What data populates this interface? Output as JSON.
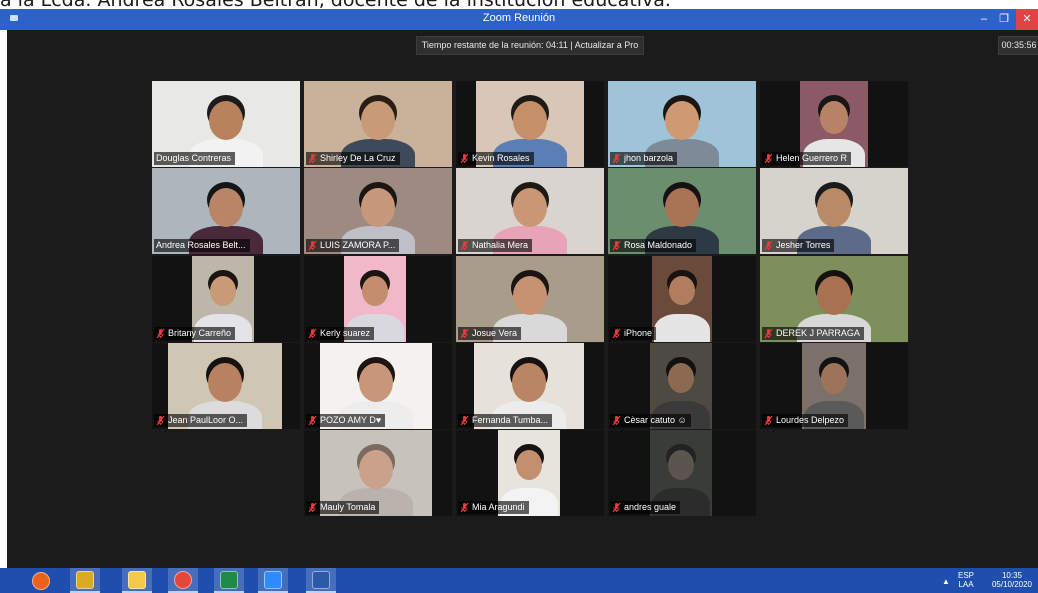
{
  "caption": "a la Lcda. Andrea Rosales Beltrán, docente de la institución educativa.",
  "window": {
    "title": "Zoom Reunión",
    "minimize": "–",
    "maximize": "❐",
    "close": "✕"
  },
  "meeting": {
    "notice": "Tiempo restante de la reunión: 04:11 | Actualizar a Pro",
    "timer": "00:35:56"
  },
  "participants": [
    {
      "name": "Douglas Contreras",
      "muted": false,
      "active": true
    },
    {
      "name": "Shirley De La Cruz",
      "muted": true
    },
    {
      "name": "Kevin Rosales",
      "muted": true
    },
    {
      "name": "jhon barzola",
      "muted": true
    },
    {
      "name": "Helen Guerrero R",
      "muted": true
    },
    {
      "name": "Andrea Rosales Belt...",
      "muted": false
    },
    {
      "name": "LUIS ZAMORA P...",
      "muted": true
    },
    {
      "name": "Nathalia Mera",
      "muted": true
    },
    {
      "name": "Rosa Maldonado",
      "muted": true
    },
    {
      "name": "Jesher Torres",
      "muted": true
    },
    {
      "name": "Britany Carreño",
      "muted": true
    },
    {
      "name": "Kerly suarez",
      "muted": true
    },
    {
      "name": "Josue Vera",
      "muted": true
    },
    {
      "name": "iPhone",
      "muted": true
    },
    {
      "name": "DEREK J PARRAGA",
      "muted": true
    },
    {
      "name": "Jean PaulLoor O...",
      "muted": true
    },
    {
      "name": "POZO AMY D♥",
      "muted": true
    },
    {
      "name": "Fernanda Tumba...",
      "muted": true
    },
    {
      "name": "Cèsar catuto ☺",
      "muted": true
    },
    {
      "name": "Lourdes Delpezo",
      "muted": true
    },
    {
      "name": "Mauly Tomala",
      "muted": true
    },
    {
      "name": "Mia Aragundi",
      "muted": true
    },
    {
      "name": "andres guale",
      "muted": true
    }
  ],
  "taskbar": {
    "apps": [
      {
        "icon": "firefox-icon",
        "color": "#e8621d"
      },
      {
        "icon": "tools-icon",
        "color": "#d9a928"
      },
      {
        "icon": "file-explorer-icon",
        "color": "#f2c94c"
      },
      {
        "icon": "chrome-icon",
        "color": "#e4473a"
      },
      {
        "icon": "excel-icon",
        "color": "#1f8a4a"
      },
      {
        "icon": "zoom-icon",
        "color": "#2d8cff"
      },
      {
        "icon": "word-icon",
        "color": "#2b5aa8"
      }
    ],
    "language": "ESP",
    "layout": "LAA",
    "time": "10:35",
    "date": "05/10/2020"
  },
  "colors": {
    "titlebar": "#2d63c8",
    "stage": "#1b1b1b",
    "active_speaker": "#d7e64a",
    "muted_mic": "#e03d3d",
    "taskbar": "#1e4fae"
  }
}
